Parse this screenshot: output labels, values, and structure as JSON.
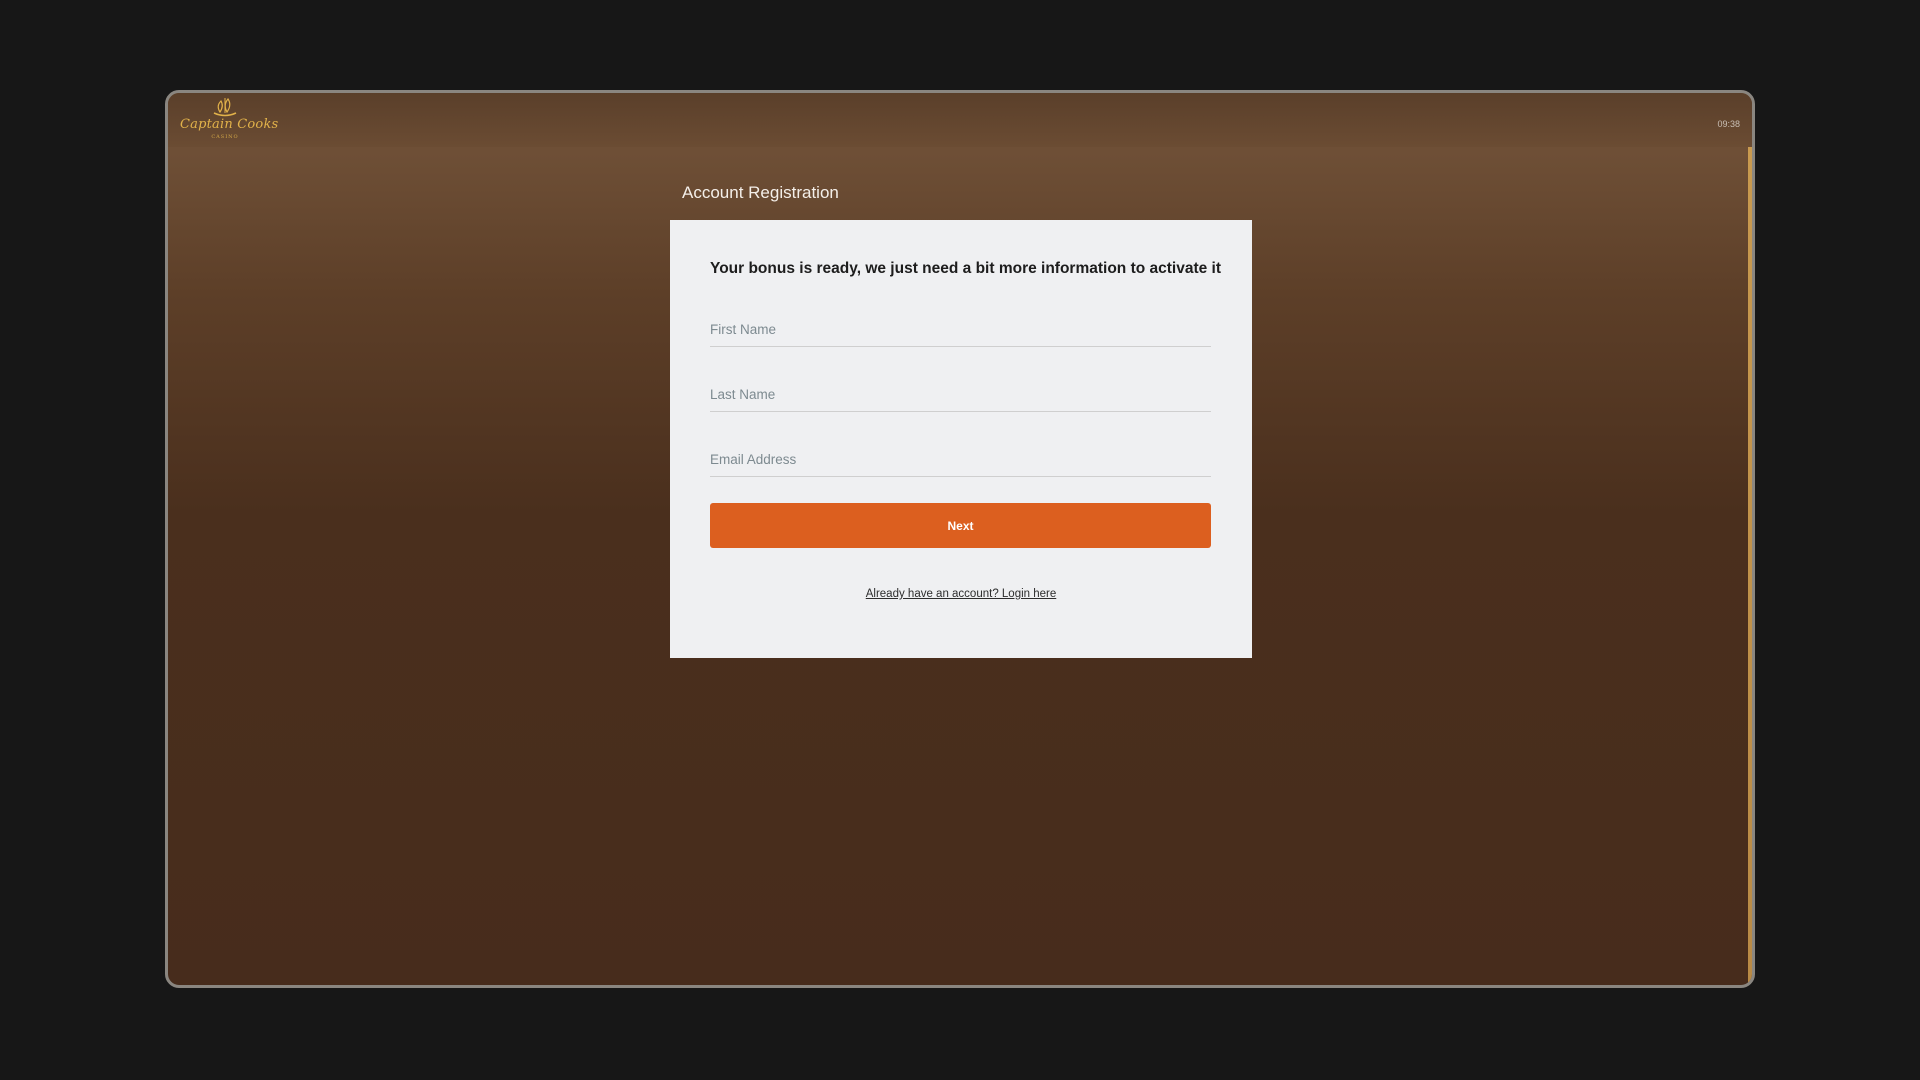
{
  "header": {
    "logo_text": "Captain Cooks",
    "logo_subtext": "CASINO",
    "clock": "09:38"
  },
  "page": {
    "title": "Account Registration"
  },
  "form": {
    "heading": "Your bonus is ready, we just need a bit more information to activate it",
    "first_name_placeholder": "First Name",
    "last_name_placeholder": "Last Name",
    "email_placeholder": "Email Address",
    "next_label": "Next",
    "login_link": "Already have an account? Login here"
  },
  "colors": {
    "accent": "#dc5f1f",
    "card_bg": "#eff0f2",
    "page_bg": "#4a2f1d",
    "logo_gold": "#e2b24a"
  },
  "icons": {
    "logo": "ship-logo-icon"
  }
}
